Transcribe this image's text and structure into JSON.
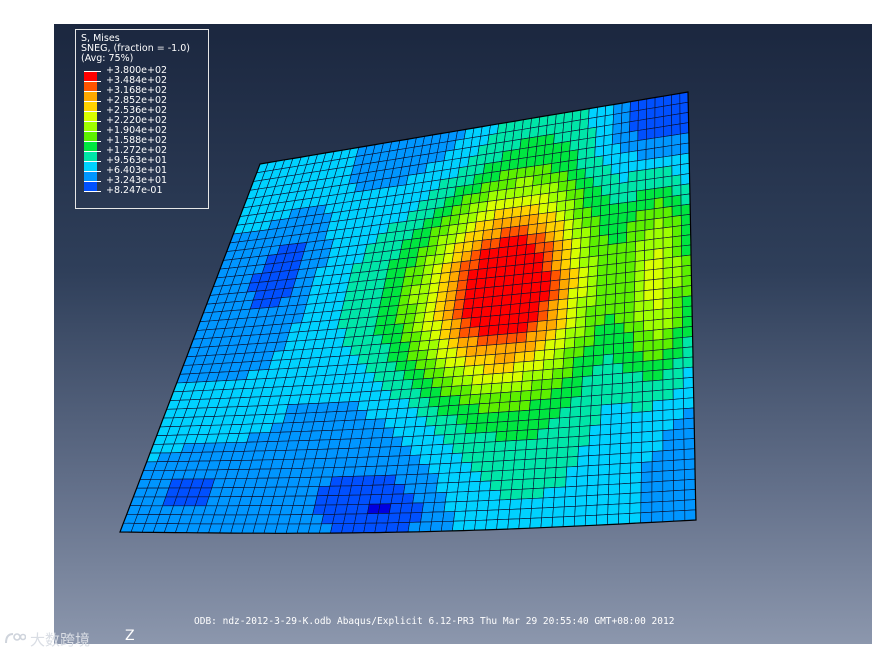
{
  "legend": {
    "title_lines": [
      "S, Mises",
      "SNEG, (fraction = -1.0)",
      "(Avg: 75%)"
    ],
    "levels": [
      "+3.800e+02",
      "+3.484e+02",
      "+3.168e+02",
      "+2.852e+02",
      "+2.536e+02",
      "+2.220e+02",
      "+1.904e+02",
      "+1.588e+02",
      "+1.272e+02",
      "+9.563e+01",
      "+6.403e+01",
      "+3.243e+01",
      "+8.247e-01"
    ],
    "colors": [
      "#ff0000",
      "#ff5400",
      "#ffa800",
      "#ffd200",
      "#d8ff00",
      "#9eff00",
      "#5cf000",
      "#00e640",
      "#00e6a8",
      "#00d2ff",
      "#0096ff",
      "#0050ff",
      "#0000e0"
    ]
  },
  "footer": "ODB: ndz-2012-3-29-K.odb    Abaqus/Explicit 6.12-PR3    Thu Mar 29 20:55:40 GMT+08:00 2012",
  "axis_label": "Z",
  "watermark": "大数跨境",
  "stress_hotspots": [
    {
      "u": 0.63,
      "v": 0.41,
      "strength": 1.0
    },
    {
      "u": 0.93,
      "v": 0.44,
      "strength": 0.35
    }
  ]
}
